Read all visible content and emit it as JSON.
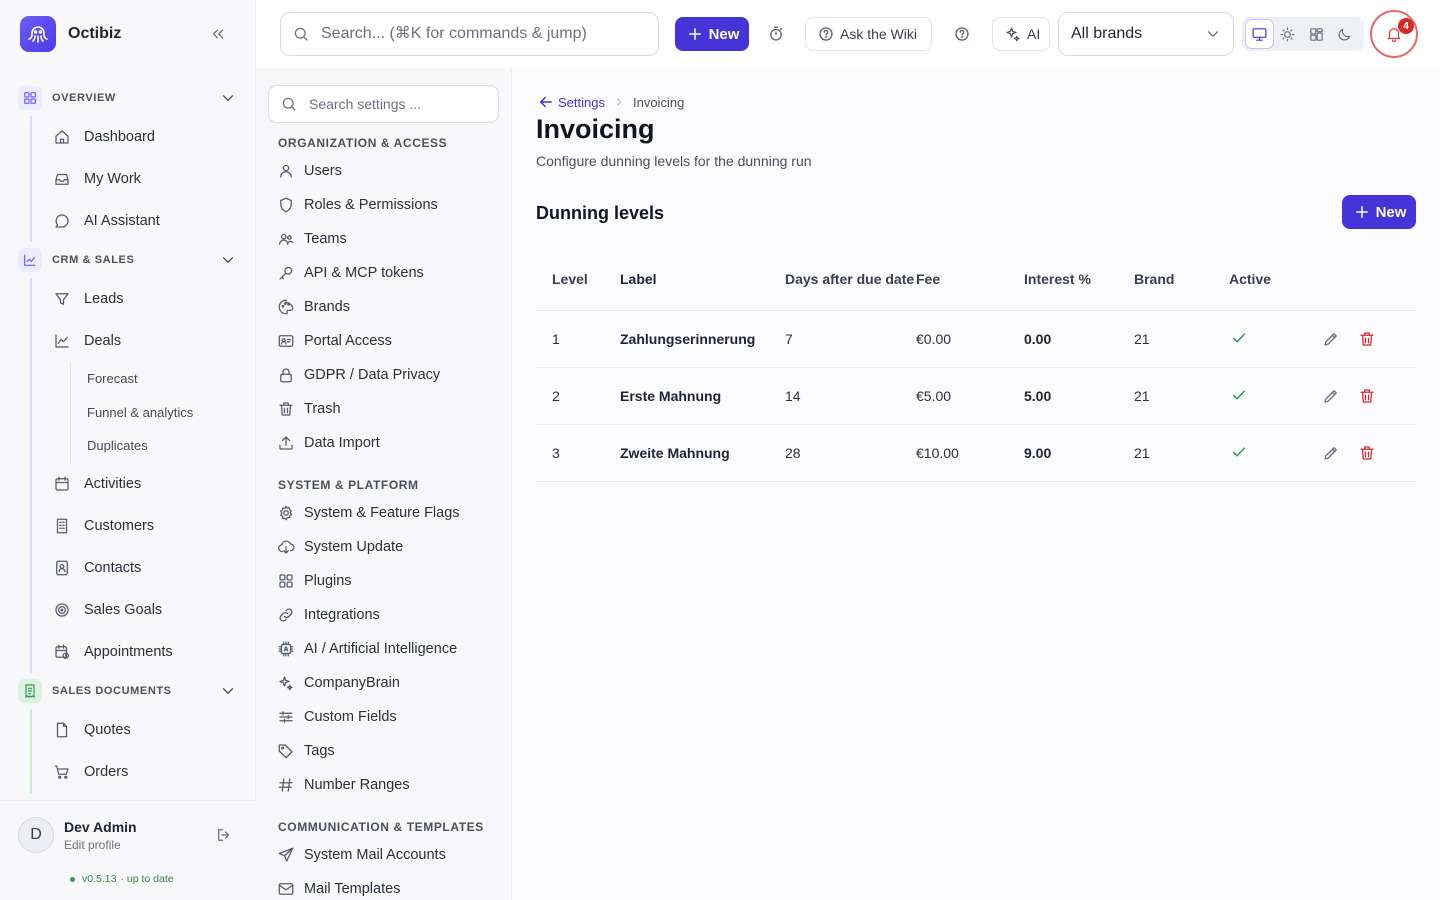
{
  "app": {
    "name": "Octibiz"
  },
  "sidebar": {
    "sections": [
      {
        "label": "OVERVIEW",
        "items": [
          "Dashboard",
          "My Work",
          "AI Assistant"
        ]
      },
      {
        "label": "CRM & SALES",
        "items": [
          "Leads",
          "Deals",
          "Activities",
          "Customers",
          "Contacts",
          "Sales Goals",
          "Appointments"
        ],
        "deal_subitems": [
          "Forecast",
          "Funnel & analytics",
          "Duplicates"
        ]
      },
      {
        "label": "SALES DOCUMENTS",
        "items": [
          "Quotes",
          "Orders"
        ]
      }
    ],
    "colors": {
      "overview": "#6d5cf5",
      "crm": "#6d5cf5",
      "sales_docs": "#2f9e4f"
    }
  },
  "user": {
    "initial": "D",
    "name": "Dev Admin",
    "sub": "Edit profile",
    "version": "v0.5.13",
    "version_status": "· up to date"
  },
  "topbar": {
    "search_placeholder": "Search... (⌘K for commands & jump)",
    "new_label": "New",
    "wiki_label": "Ask the Wiki",
    "ai_label": "AI",
    "brand_select": "All brands",
    "notifications": "4"
  },
  "settings_nav": {
    "search_placeholder": "Search settings ...",
    "groups": [
      {
        "heading": "ORGANIZATION & ACCESS",
        "items": [
          {
            "label": "Users",
            "icon": "user-icon"
          },
          {
            "label": "Roles & Permissions",
            "icon": "shield-icon"
          },
          {
            "label": "Teams",
            "icon": "team-icon"
          },
          {
            "label": "API & MCP tokens",
            "icon": "key-icon"
          },
          {
            "label": "Brands",
            "icon": "palette-icon"
          },
          {
            "label": "Portal Access",
            "icon": "id-card-icon"
          },
          {
            "label": "GDPR / Data Privacy",
            "icon": "lock-icon"
          },
          {
            "label": "Trash",
            "icon": "trash-icon"
          },
          {
            "label": "Data Import",
            "icon": "upload-icon"
          }
        ]
      },
      {
        "heading": "SYSTEM & PLATFORM",
        "items": [
          {
            "label": "System & Feature Flags",
            "icon": "gear-icon"
          },
          {
            "label": "System Update",
            "icon": "cloud-download-icon"
          },
          {
            "label": "Plugins",
            "icon": "grid-icon"
          },
          {
            "label": "Integrations",
            "icon": "link-icon"
          },
          {
            "label": "AI / Artificial Intelligence",
            "icon": "chip-icon"
          },
          {
            "label": "CompanyBrain",
            "icon": "sparkles-icon"
          },
          {
            "label": "Custom Fields",
            "icon": "sliders-icon"
          },
          {
            "label": "Tags",
            "icon": "tag-icon"
          },
          {
            "label": "Number Ranges",
            "icon": "hash-icon"
          }
        ]
      },
      {
        "heading": "COMMUNICATION & TEMPLATES",
        "items": [
          {
            "label": "System Mail Accounts",
            "icon": "send-icon"
          },
          {
            "label": "Mail Templates",
            "icon": "mail-icon"
          }
        ]
      }
    ]
  },
  "main": {
    "breadcrumb": {
      "parent": "Settings",
      "current": "Invoicing"
    },
    "title": "Invoicing",
    "description": "Configure dunning levels for the dunning run",
    "section_title": "Dunning levels",
    "new_label": "New",
    "table": {
      "headers": {
        "level": "Level",
        "label": "Label",
        "days": "Days after due date",
        "fee": "Fee",
        "interest": "Interest %",
        "brand": "Brand",
        "active": "Active"
      },
      "rows": [
        {
          "level": "1",
          "label": "Zahlungserinnerung",
          "days": "7",
          "fee": "€0.00",
          "interest": "0.00",
          "brand": "21",
          "active": true
        },
        {
          "level": "2",
          "label": "Erste Mahnung",
          "days": "14",
          "fee": "€5.00",
          "interest": "5.00",
          "brand": "21",
          "active": true
        },
        {
          "level": "3",
          "label": "Zweite Mahnung",
          "days": "28",
          "fee": "€10.00",
          "interest": "9.00",
          "brand": "21",
          "active": true
        }
      ]
    }
  },
  "colors": {
    "accent": "#4535d8",
    "danger": "#d42a2a",
    "success": "#2e9a4e"
  }
}
